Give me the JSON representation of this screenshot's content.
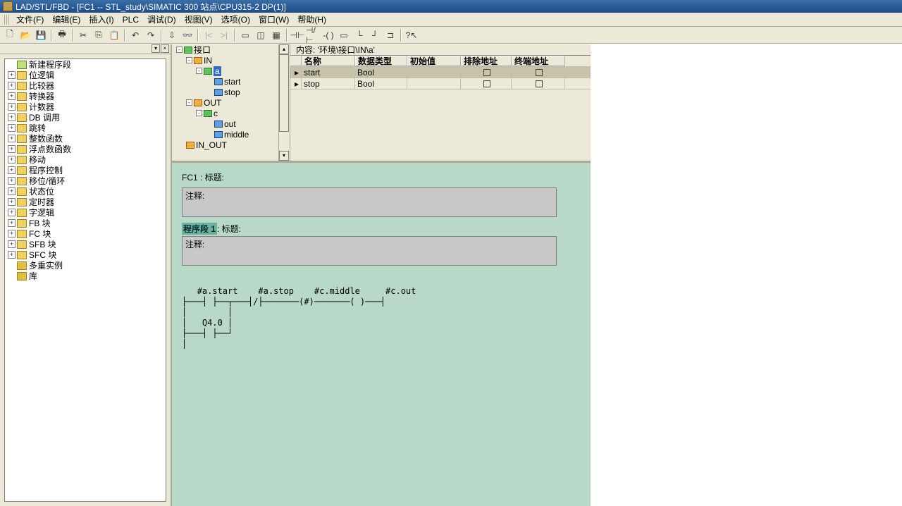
{
  "title": "LAD/STL/FBD  - [FC1 -- STL_study\\SIMATIC 300 站点\\CPU315-2 DP(1)]",
  "menus": [
    "文件(F)",
    "编辑(E)",
    "插入(I)",
    "PLC",
    "调试(D)",
    "视图(V)",
    "选项(O)",
    "窗口(W)",
    "帮助(H)"
  ],
  "left_tree": [
    {
      "icon": "new",
      "label": "新建程序段"
    },
    {
      "icon": "fold",
      "label": "位逻辑"
    },
    {
      "icon": "fold",
      "label": "比较器"
    },
    {
      "icon": "fold",
      "label": "转换器"
    },
    {
      "icon": "fold",
      "label": "计数器"
    },
    {
      "icon": "fold",
      "label": "DB 调用"
    },
    {
      "icon": "fold",
      "label": "跳转"
    },
    {
      "icon": "fold",
      "label": "整数函数"
    },
    {
      "icon": "fold",
      "label": "浮点数函数"
    },
    {
      "icon": "fold",
      "label": "移动"
    },
    {
      "icon": "fold",
      "label": "程序控制"
    },
    {
      "icon": "fold",
      "label": "移位/循环"
    },
    {
      "icon": "fold",
      "label": "状态位"
    },
    {
      "icon": "fold",
      "label": "定时器"
    },
    {
      "icon": "fold",
      "label": "字逻辑"
    },
    {
      "icon": "fold",
      "label": "FB 块"
    },
    {
      "icon": "fold",
      "label": "FC 块"
    },
    {
      "icon": "fold",
      "label": "SFB 块"
    },
    {
      "icon": "fold",
      "label": "SFC 块"
    },
    {
      "icon": "lib",
      "label": "多重实例"
    },
    {
      "icon": "lib",
      "label": "库"
    }
  ],
  "iface_header": "内容:    '环境\\接口\\IN\\a'",
  "iface_tree": {
    "root": "接口",
    "in": "IN",
    "in_a": "a",
    "in_start": "start",
    "in_stop": "stop",
    "out": "OUT",
    "out_c": "c",
    "out_out": "out",
    "out_middle": "middle",
    "inout": "IN_OUT"
  },
  "var_table": {
    "cols": [
      "名称",
      "数据类型",
      "初始值",
      "排除地址",
      "终端地址"
    ],
    "rows": [
      {
        "name": "start",
        "type": "Bool",
        "sel": true
      },
      {
        "name": "stop",
        "type": "Bool",
        "sel": false
      }
    ]
  },
  "editor": {
    "fc_title": "FC1 : 标题:",
    "comment": "注释:",
    "segment": "程序段 1",
    "seg_title": ": 标题:",
    "ladder_labels": {
      "a": "#a.start",
      "b": "#a.stop",
      "c": "#c.middle",
      "d": "#c.out",
      "q": "Q4.0"
    }
  }
}
